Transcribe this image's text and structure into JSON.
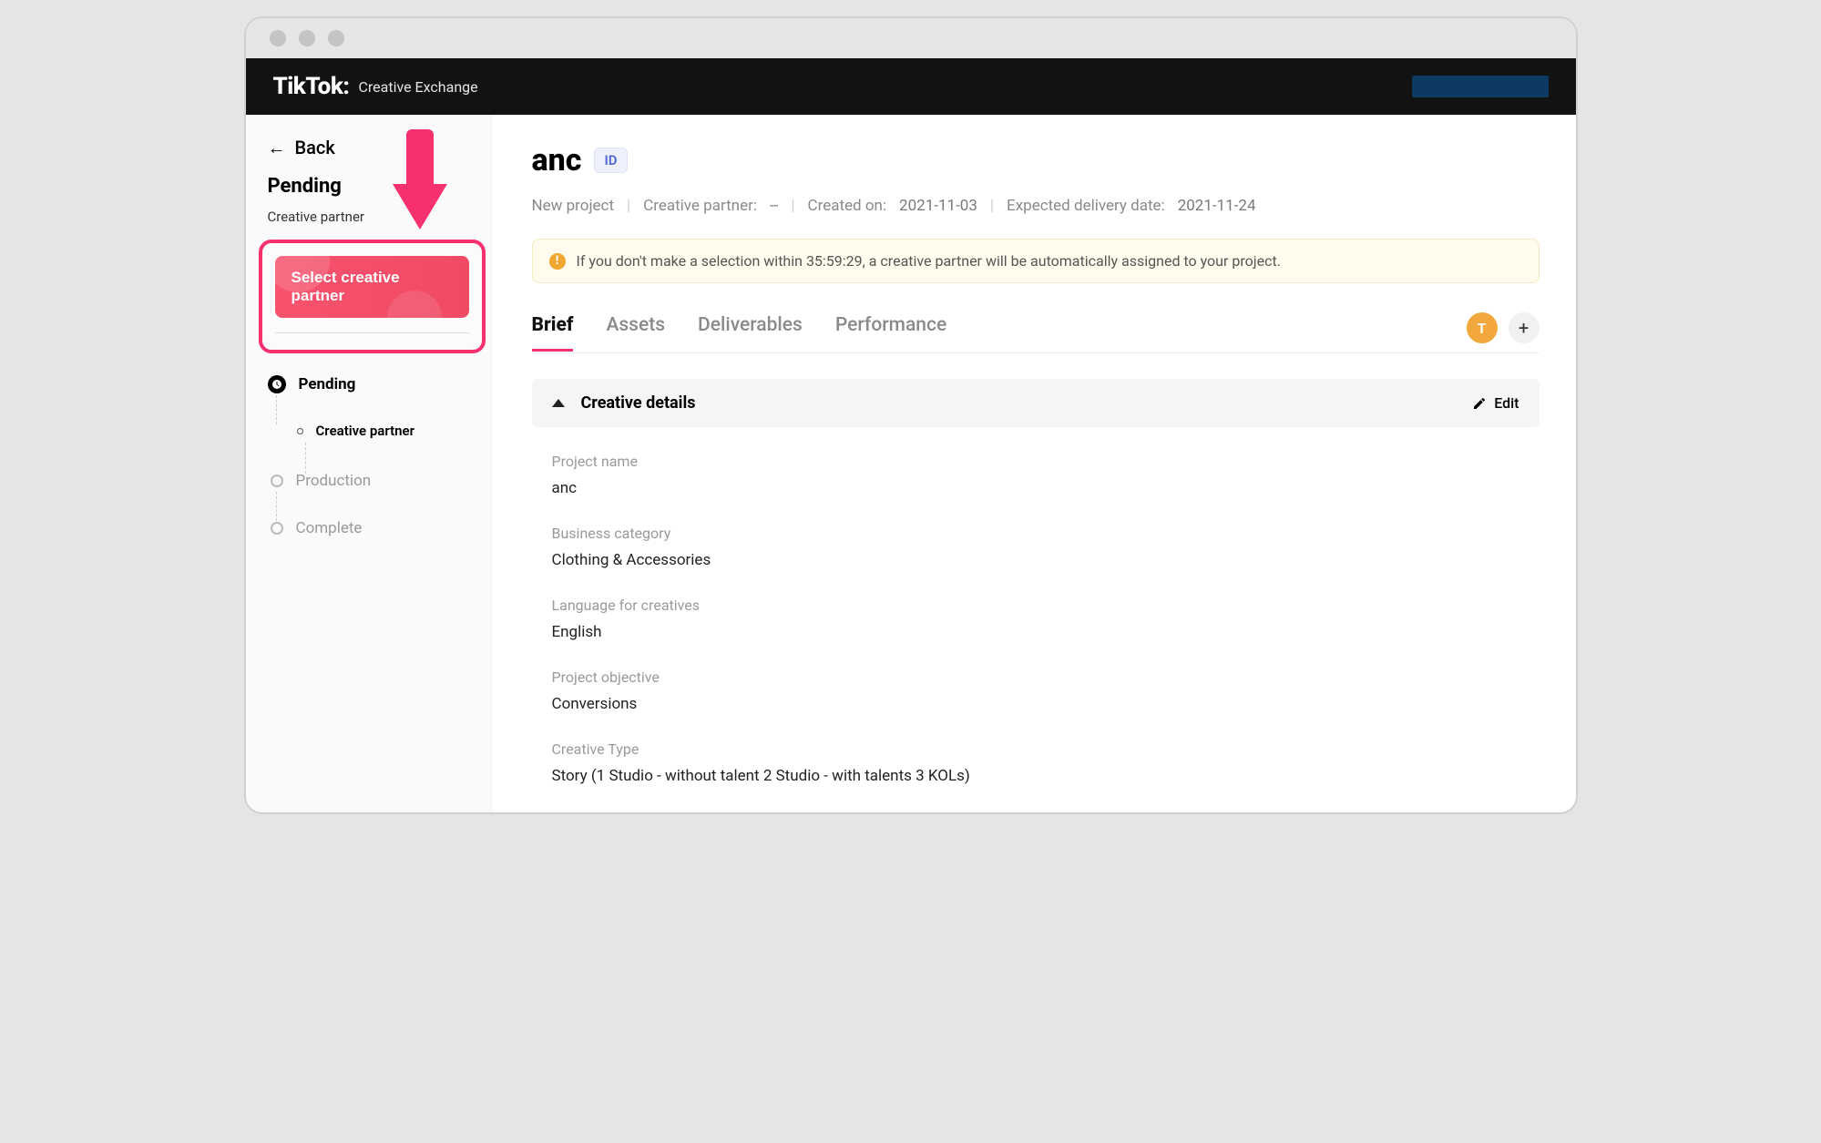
{
  "brand": {
    "title": "TikTok:",
    "subtitle": "Creative Exchange"
  },
  "sidebar": {
    "back": "Back",
    "heading": "Pending",
    "subheading": "Creative partner",
    "cta": "Select creative partner",
    "timeline": {
      "pending": "Pending",
      "creative_partner": "Creative partner",
      "production": "Production",
      "complete": "Complete"
    }
  },
  "main": {
    "title": "anc",
    "id_label": "ID",
    "meta": {
      "status": "New project",
      "partner_label": "Creative partner:",
      "partner_value": "--",
      "created_label": "Created on:",
      "created_value": "2021-11-03",
      "expected_label": "Expected delivery date:",
      "expected_value": "2021-11-24"
    },
    "alert": "If you don't make a selection within 35:59:29, a creative partner will be automatically assigned to your project.",
    "tabs": [
      "Brief",
      "Assets",
      "Deliverables",
      "Performance"
    ],
    "avatar_letter": "T",
    "panel_title": "Creative details",
    "edit_label": "Edit",
    "fields": [
      {
        "label": "Project name",
        "value": "anc"
      },
      {
        "label": "Business category",
        "value": "Clothing & Accessories"
      },
      {
        "label": "Language for creatives",
        "value": "English"
      },
      {
        "label": "Project objective",
        "value": "Conversions"
      },
      {
        "label": "Creative Type",
        "value": "Story (1 Studio - without talent 2 Studio - with talents 3 KOLs)"
      }
    ]
  }
}
